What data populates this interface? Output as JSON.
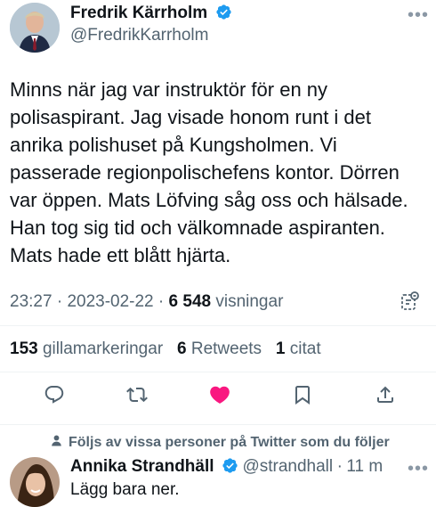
{
  "tweet": {
    "author_name": "Fredrik Kärrholm",
    "author_handle": "@FredrikKarrholm",
    "more_label": "•••",
    "text": "Minns när jag var instruktör för en ny polisaspirant. Jag visade honom runt i det anrika polishuset på Kungsholmen. Vi passerade regionpolischefens kontor. Dörren var öppen. Mats Löfving såg oss och hälsade. Han tog sig tid och välkomnade aspiranten. Mats hade ett blått hjärta.",
    "time": "23:27",
    "date": "2023-02-22",
    "views_count": "6 548",
    "views_label": "visningar",
    "separator": "·"
  },
  "stats": {
    "likes_count": "153",
    "likes_label": "gillamarkeringar",
    "retweets_count": "6",
    "retweets_label": "Retweets",
    "quotes_count": "1",
    "quotes_label": "citat"
  },
  "actions": {
    "icons": [
      "reply-icon",
      "retweet-icon",
      "like-icon",
      "bookmark-icon",
      "share-icon"
    ],
    "like_color": "#f91880",
    "icon_color": "#536471"
  },
  "reply_context": {
    "text": "Följs av vissa personer på Twitter som du följer"
  },
  "reply": {
    "author_name": "Annika Strandhäll",
    "author_handle": "@strandhall",
    "separator": "·",
    "time_ago": "11 m",
    "text": "Lägg bara ner.",
    "more_label": "•••"
  },
  "colors": {
    "verified": "#1d9bf0",
    "secondary_text": "#536471",
    "primary_text": "#0f1419"
  }
}
